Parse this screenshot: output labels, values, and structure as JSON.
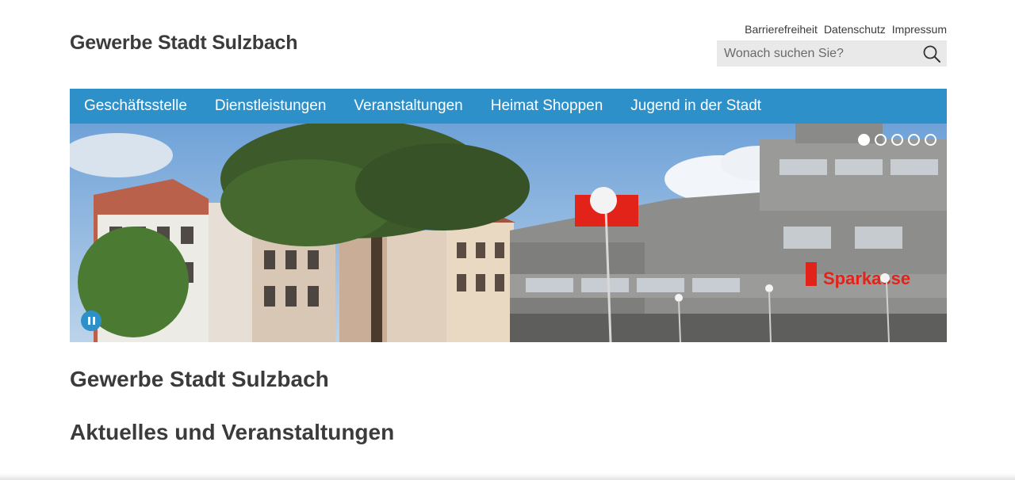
{
  "header": {
    "site_title": "Gewerbe Stadt Sulzbach",
    "meta_links": [
      "Barrierefreiheit",
      "Datenschutz",
      "Impressum"
    ],
    "search": {
      "placeholder": "Wonach suchen Sie?",
      "icon": "search-icon"
    }
  },
  "nav": {
    "items": [
      "Geschäftsstelle",
      "Dienstleistungen",
      "Veranstaltungen",
      "Heimat Shoppen",
      "Jugend in der Stadt"
    ]
  },
  "slider": {
    "slide_count": 5,
    "active_index": 0,
    "pause_icon": "pause-icon",
    "sign_text": "Sparkasse"
  },
  "main": {
    "page_heading": "Gewerbe Stadt Sulzbach",
    "news_heading": "Aktuelles und Veranstaltungen"
  },
  "colors": {
    "brand_blue": "#2e90c9",
    "text": "#3b3b3b",
    "search_bg": "#e9e9e9",
    "sparkasse_red": "#e2231a"
  }
}
